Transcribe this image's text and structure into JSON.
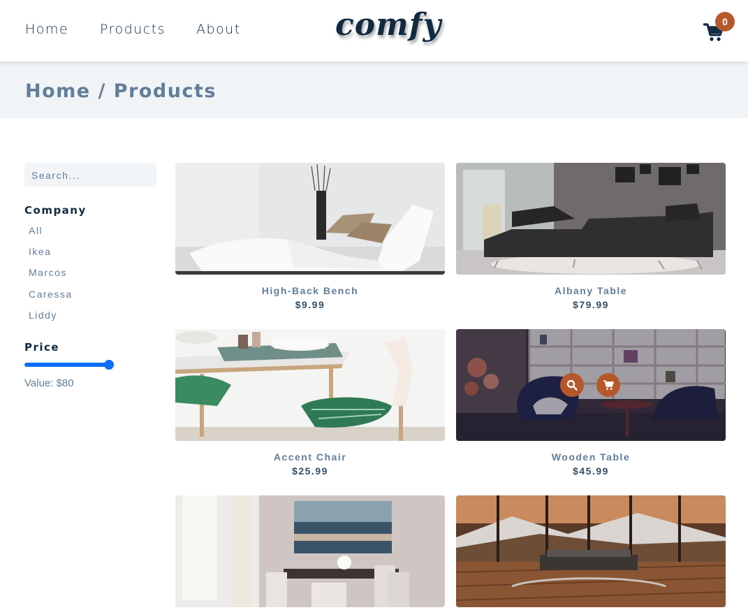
{
  "nav": {
    "links": [
      "Home",
      "Products",
      "About"
    ],
    "logo": "comfy",
    "cart_count": "0"
  },
  "hero": {
    "title": "Home / Products"
  },
  "filters": {
    "search_placeholder": "Search...",
    "company_heading": "Company",
    "companies": [
      "All",
      "Ikea",
      "Marcos",
      "Caressa",
      "Liddy"
    ],
    "price_heading": "Price",
    "price_value": "Value: $80",
    "price_fraction": 0.92
  },
  "products": [
    {
      "name": "High-Back Bench",
      "price": "$9.99"
    },
    {
      "name": "Albany Table",
      "price": "$79.99"
    },
    {
      "name": "Accent Chair",
      "price": "$25.99"
    },
    {
      "name": "Wooden Table",
      "price": "$45.99"
    },
    {
      "name": "",
      "price": ""
    },
    {
      "name": "",
      "price": ""
    }
  ],
  "colors": {
    "accent": "#b5582b",
    "slider": "#0b6ef5",
    "text_dark": "#102a42",
    "text_muted": "#617d98"
  },
  "icons": [
    "cart-icon",
    "search-icon"
  ]
}
